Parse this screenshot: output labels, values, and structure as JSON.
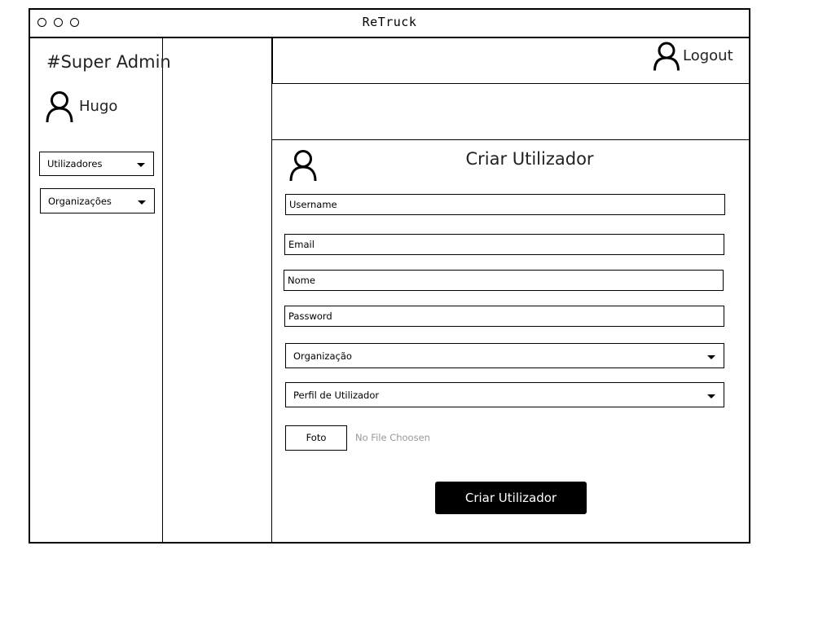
{
  "app": {
    "title": "ReTruck"
  },
  "sidebar": {
    "role": "#Super Admin",
    "user_name": "Hugo",
    "menus": [
      {
        "label": "Utilizadores"
      },
      {
        "label": "Organizações"
      }
    ]
  },
  "header": {
    "logout_label": "Logout"
  },
  "form": {
    "title": "Criar Utilizador",
    "fields": {
      "username": {
        "placeholder": "Username",
        "value": ""
      },
      "email": {
        "placeholder": "Email",
        "value": ""
      },
      "nome": {
        "placeholder": "Nome",
        "value": ""
      },
      "password": {
        "placeholder": "Password",
        "value": ""
      }
    },
    "selects": {
      "organizacao": {
        "selected": "Organização"
      },
      "perfil": {
        "selected": "Perfil de Utilizador"
      }
    },
    "photo": {
      "button_label": "Foto",
      "status": "No File Choosen"
    },
    "submit_label": "Criar Utilizador"
  },
  "icons": {
    "window_controls": [
      "window-dot-icon",
      "window-dot-icon",
      "window-dot-icon"
    ],
    "user": "user-icon",
    "caret": "caret-down-icon"
  }
}
